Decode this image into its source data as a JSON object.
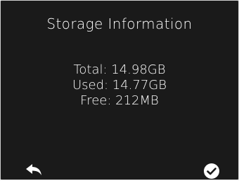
{
  "screen": {
    "title": "Storage Information",
    "storage": {
      "total": "Total: 14.98GB",
      "used": "Used: 14.77GB",
      "free": "Free: 212MB"
    }
  },
  "footer": {
    "back_icon": "back-arrow-icon",
    "confirm_icon": "checkmark-circle-icon"
  },
  "colors": {
    "background": "#1a1a1a",
    "text": "#ffffff"
  }
}
